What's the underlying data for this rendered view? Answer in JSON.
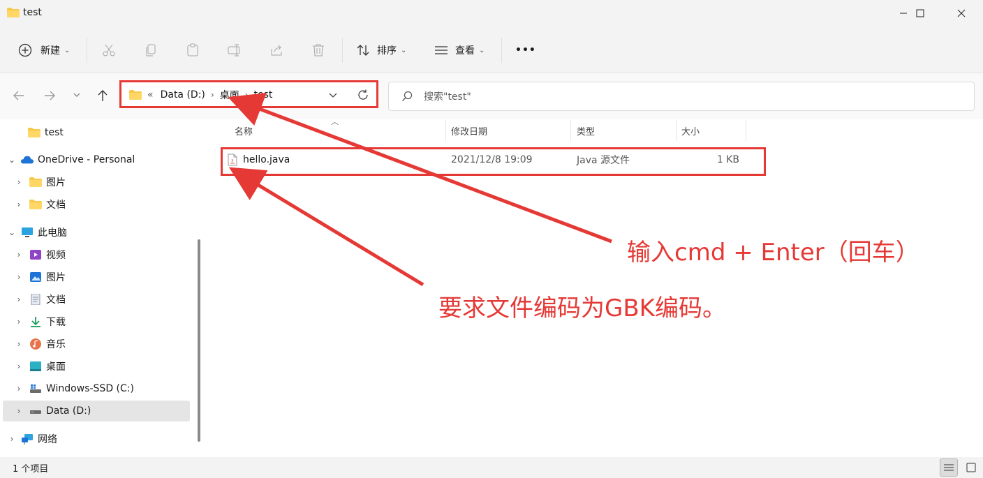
{
  "window": {
    "title": "test",
    "controls": {
      "minimize": "–",
      "maximize": "☐",
      "close": "✕"
    }
  },
  "toolbar": {
    "new_label": "新建",
    "sort_label": "排序",
    "view_label": "查看",
    "more_label": "•••"
  },
  "address": {
    "overflow": "«",
    "crumbs": [
      "Data (D:)",
      "桌面",
      "test"
    ]
  },
  "search": {
    "placeholder": "搜索\"test\""
  },
  "sidebar": {
    "pinned": "test",
    "onedrive": "OneDrive - Personal",
    "onedrive_items": [
      "图片",
      "文档"
    ],
    "thispc": "此电脑",
    "thispc_items": [
      "视频",
      "图片",
      "文档",
      "下载",
      "音乐",
      "桌面",
      "Windows-SSD (C:)",
      "Data (D:)"
    ],
    "network": "网络"
  },
  "columns": {
    "name": "名称",
    "modified": "修改日期",
    "type": "类型",
    "size": "大小"
  },
  "files": [
    {
      "name": "hello.java",
      "modified": "2021/12/8 19:09",
      "type": "Java 源文件",
      "size": "1 KB"
    }
  ],
  "status": {
    "count": "1 个项目"
  },
  "annotations": {
    "cmd_note": "输入cmd + Enter（回车）",
    "encoding_note": "要求文件编码为GBK编码。"
  },
  "colors": {
    "annotation_red": "#e53935",
    "selection": "#e5e5e5",
    "folder": "#f8c84a"
  }
}
